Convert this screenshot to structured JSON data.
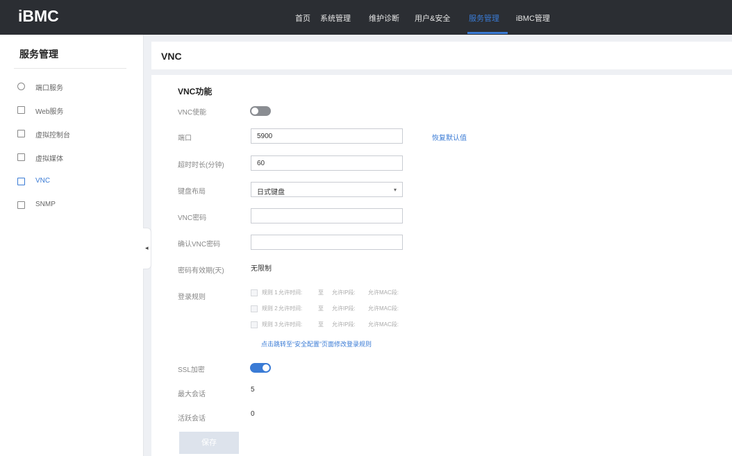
{
  "header": {
    "logo": "iBMC",
    "nav": [
      {
        "label": "首页"
      },
      {
        "label": "系统管理"
      },
      {
        "label": "维护诊断"
      },
      {
        "label": "用户&安全"
      },
      {
        "label": "服务管理"
      },
      {
        "label": "iBMC管理"
      }
    ],
    "active_nav": "服务管理"
  },
  "sidebar": {
    "title": "服务管理",
    "items": [
      {
        "label": "端口服务",
        "icon": "globe-icon"
      },
      {
        "label": "Web服务",
        "icon": "web-icon"
      },
      {
        "label": "虚拟控制台",
        "icon": "monitor-icon"
      },
      {
        "label": "虚拟媒体",
        "icon": "media-icon"
      },
      {
        "label": "VNC",
        "icon": "vnc-icon"
      },
      {
        "label": "SNMP",
        "icon": "snmp-icon"
      }
    ],
    "active_item": "VNC",
    "collapse_glyph": "◂"
  },
  "page": {
    "title": "VNC"
  },
  "form": {
    "section_title": "VNC功能",
    "vnc_enable": {
      "label": "VNC使能",
      "state": "off"
    },
    "port": {
      "label": "端口",
      "value": "5900",
      "restore_link": "恢复默认值"
    },
    "timeout": {
      "label": "超时时长(分钟)",
      "value": "60"
    },
    "keyboard": {
      "label": "键盘布局",
      "value": "日式键盘",
      "arrow": "▾"
    },
    "password": {
      "label": "VNC密码",
      "value": ""
    },
    "confirm_password": {
      "label": "确认VNC密码",
      "value": ""
    },
    "password_validity": {
      "label": "密码有效期(天)",
      "value": "无限制"
    },
    "login_rules": {
      "label": "登录规则",
      "rules": [
        {
          "name": "规则 1",
          "time": "允许时间:",
          "to": "至",
          "ip": "允许IP段:",
          "mac": "允许MAC段:"
        },
        {
          "name": "规则 2",
          "time": "允许时间:",
          "to": "至",
          "ip": "允许IP段:",
          "mac": "允许MAC段:"
        },
        {
          "name": "规则 3",
          "time": "允许时间:",
          "to": "至",
          "ip": "允许IP段:",
          "mac": "允许MAC段:"
        }
      ],
      "link": "点击跳转至“安全配置”页面修改登录规则"
    },
    "ssl": {
      "label": "SSL加密",
      "state": "on"
    },
    "max_sessions": {
      "label": "最大会话",
      "value": "5"
    },
    "active_sessions": {
      "label": "活跃会话",
      "value": "0"
    },
    "save_label": "保存"
  },
  "colors": {
    "topbar": "#2b2e33",
    "accent": "#3a7bd5",
    "background": "#eef0f4"
  }
}
